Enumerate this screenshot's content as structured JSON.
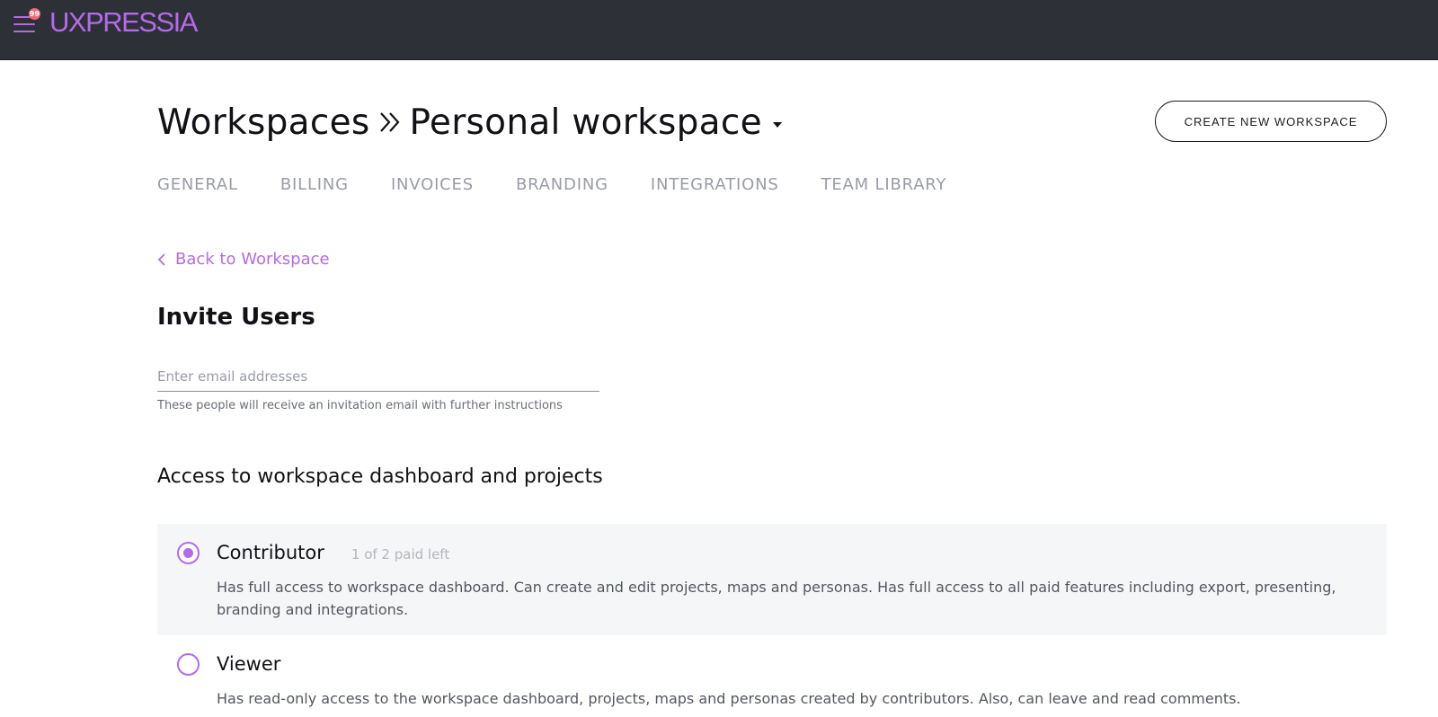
{
  "header": {
    "logo_text": "UXPRESSIA",
    "notification_count": "99",
    "accent_color": "#b56ae8",
    "bar_color": "#2e3038"
  },
  "breadcrumb": {
    "root": "Workspaces",
    "current": "Personal workspace"
  },
  "actions": {
    "create_workspace_label": "CREATE NEW WORKSPACE"
  },
  "tabs": [
    {
      "label": "GENERAL"
    },
    {
      "label": "BILLING"
    },
    {
      "label": "INVOICES"
    },
    {
      "label": "BRANDING"
    },
    {
      "label": "INTEGRATIONS"
    },
    {
      "label": "TEAM LIBRARY"
    }
  ],
  "back_link": {
    "label": "Back to Workspace"
  },
  "invite": {
    "title": "Invite Users",
    "email_placeholder": "Enter email addresses",
    "email_value": "",
    "helper_text": "These people will receive an invitation email with further instructions"
  },
  "access": {
    "title": "Access to workspace dashboard and projects",
    "roles": [
      {
        "name": "Contributor",
        "quota": "1 of 2 paid left",
        "selected": true,
        "description": "Has full access to workspace dashboard. Can create and edit projects, maps and personas. Has full access to all paid features including export, presenting, branding and integrations."
      },
      {
        "name": "Viewer",
        "selected": false,
        "description": "Has read-only access to the workspace dashboard, projects, maps and personas created by contributors. Also, can leave and read comments."
      }
    ]
  },
  "icons": {
    "menu": "hamburger-menu-icon",
    "separator": "double-chevron-right-icon",
    "dropdown": "caret-down-icon",
    "back": "chevron-left-icon"
  }
}
